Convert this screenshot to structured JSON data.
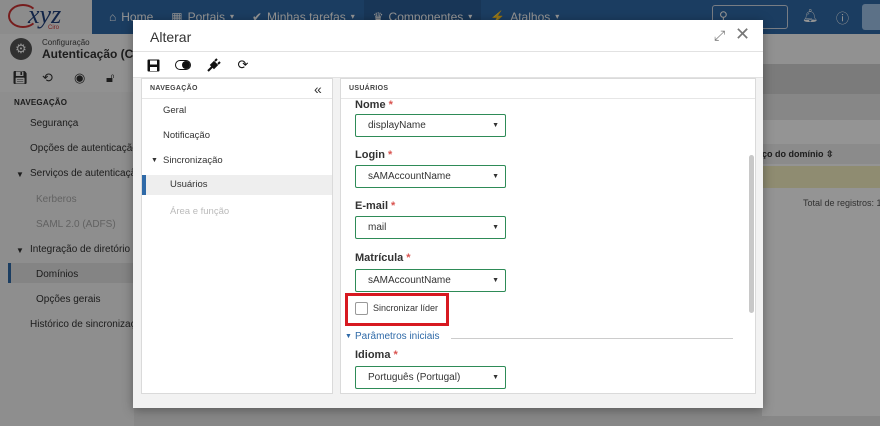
{
  "background": {
    "logo": {
      "text": "xyz",
      "sub": "Ciro"
    },
    "nav": [
      {
        "icon": "home-icon",
        "glyph": "⌂",
        "label": "Home",
        "active": false
      },
      {
        "icon": "grid-icon",
        "glyph": "▦",
        "label": "Portais",
        "caret": "▾",
        "active": false
      },
      {
        "icon": "check-icon",
        "glyph": "✔",
        "label": "Minhas tarefas",
        "caret": "▾",
        "active": false
      },
      {
        "icon": "trophy-icon",
        "glyph": "♛",
        "label": "Componentes",
        "caret": "▾",
        "active": true
      },
      {
        "icon": "bolt-icon",
        "glyph": "⚡",
        "label": "Atalhos",
        "caret": "▾",
        "active": false
      }
    ],
    "app_subtitle": "Configuração",
    "app_title": "Autenticação (CM",
    "sidebar": {
      "heading": "NAVEGAÇÃO",
      "items": {
        "seguranca": "Segurança",
        "opcoes_autenticacao": "Opções de autenticação",
        "servicos_autenticacao": "Serviços de autenticação",
        "kerberos": "Kerberos",
        "saml": "SAML 2.0 (ADFS)",
        "integracao": "Integração de diretório",
        "dominios": "Domínios",
        "opcoes_gerais": "Opções gerais",
        "historico": "Histórico de sincronizaçõe"
      }
    },
    "grid": {
      "column_header": "ço do domínio",
      "total": "Total de registros: 1"
    }
  },
  "modal": {
    "title": "Alterar",
    "nav_panel": {
      "heading": "NAVEGAÇÃO",
      "items": {
        "geral": "Geral",
        "notificacao": "Notificação",
        "sincronizacao": "Sincronização",
        "usuarios": "Usuários",
        "area_funcao": "Área e função"
      }
    },
    "form_panel": {
      "heading": "USUÁRIOS",
      "fields": {
        "nome": {
          "label": "Nome",
          "value": "displayName"
        },
        "login": {
          "label": "Login",
          "value": "sAMAccountName"
        },
        "email": {
          "label": "E-mail",
          "value": "mail"
        },
        "matricula": {
          "label": "Matrícula",
          "value": "sAMAccountName"
        },
        "idioma": {
          "label": "Idioma",
          "value": "Português (Portugal)"
        }
      },
      "required_mark": "*",
      "checkbox_label": "Sincronizar líder",
      "section_title": "Parâmetros iniciais"
    }
  },
  "colors": {
    "brand": "#2f6aa8",
    "required": "#d9534f",
    "highlight": "#d71920",
    "select_border": "#2e8b57"
  }
}
